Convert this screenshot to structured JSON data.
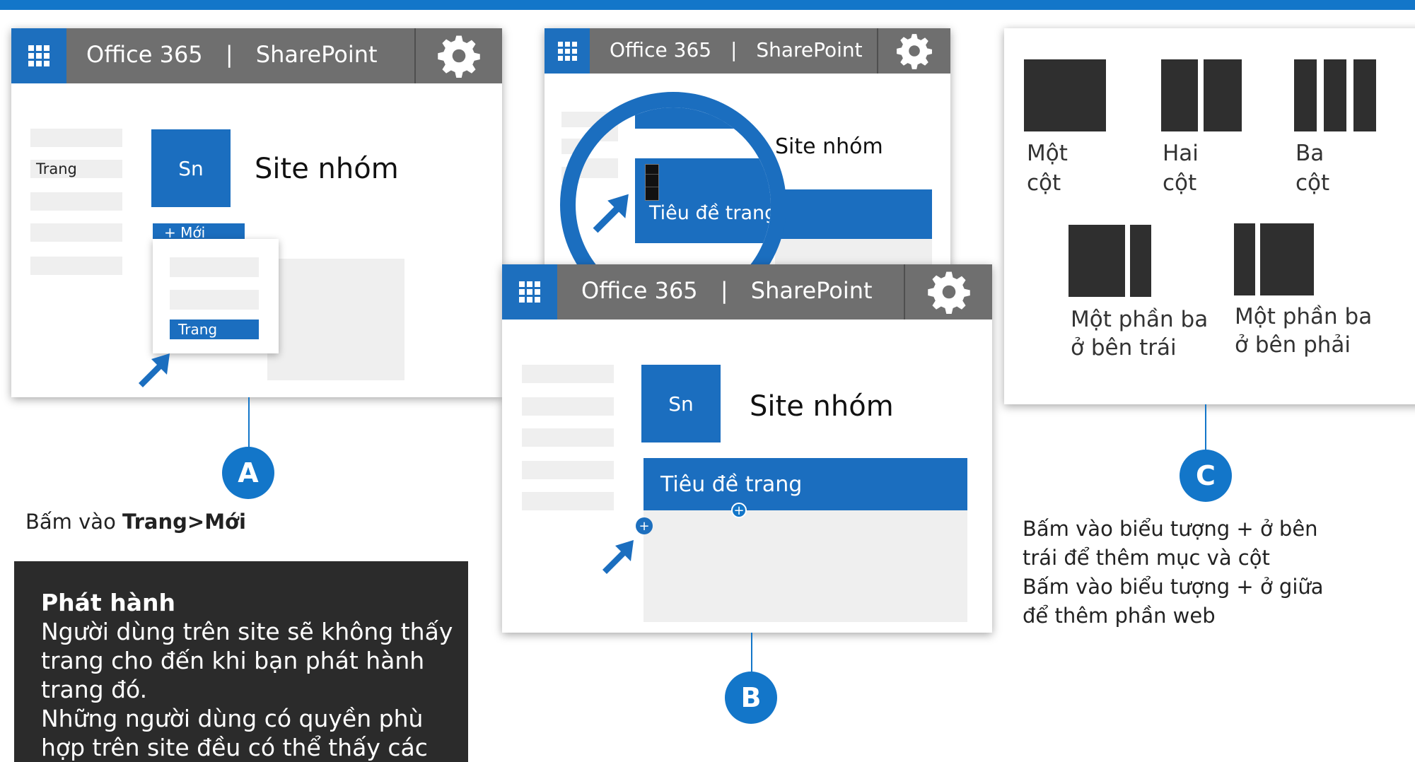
{
  "header": {
    "brand": "Office 365",
    "separator": "|",
    "product": "SharePoint"
  },
  "site": {
    "tile_initials": "Sn",
    "name": "Site nhóm"
  },
  "panel_a": {
    "sidebar_item": "Trang",
    "new_button": "+ Mới",
    "dropdown_selected": "Trang"
  },
  "panel_b": {
    "page_title": "Tiêu đề trang",
    "add_glyph": "+"
  },
  "magnifier": {
    "site_name": "Site nhóm",
    "page_title": "Tiêu đề trang"
  },
  "layouts": [
    {
      "line1": "Một",
      "line2": "cột"
    },
    {
      "line1": "Hai",
      "line2": "cột"
    },
    {
      "line1": "Ba",
      "line2": "cột"
    },
    {
      "line1": "Một phần ba",
      "line2": "ở bên trái"
    },
    {
      "line1": "Một phần ba",
      "line2": "ở bên phải"
    }
  ],
  "steps": {
    "a": {
      "badge": "A",
      "prefix": "Bấm vào ",
      "bold": "Trang>Mới"
    },
    "b": {
      "badge": "B"
    },
    "c": {
      "badge": "C",
      "line1": "Bấm vào biểu tượng + ở bên",
      "line2": "trái để thêm mục và cột",
      "line3": "Bấm vào biểu tượng + ở giữa",
      "line4": "để thêm phần web"
    }
  },
  "publish_box": {
    "title": "Phát hành",
    "line1": "Người dùng trên site sẽ không thấy",
    "line2": "trang cho đến khi bạn phát hành",
    "line3": "trang đó.",
    "line4": "Những người dùng có quyền phù",
    "line5": "hợp trên site đều có thể thấy các"
  },
  "colors": {
    "accent": "#1376c9",
    "tile_blue": "#1b6ebf",
    "header_gray": "#6f6f6f",
    "dark_box": "#2b2b2b"
  },
  "icons": [
    "waffle-icon",
    "gear-icon",
    "cursor-arrow-icon",
    "plus-icon",
    "magnifier-icon"
  ]
}
